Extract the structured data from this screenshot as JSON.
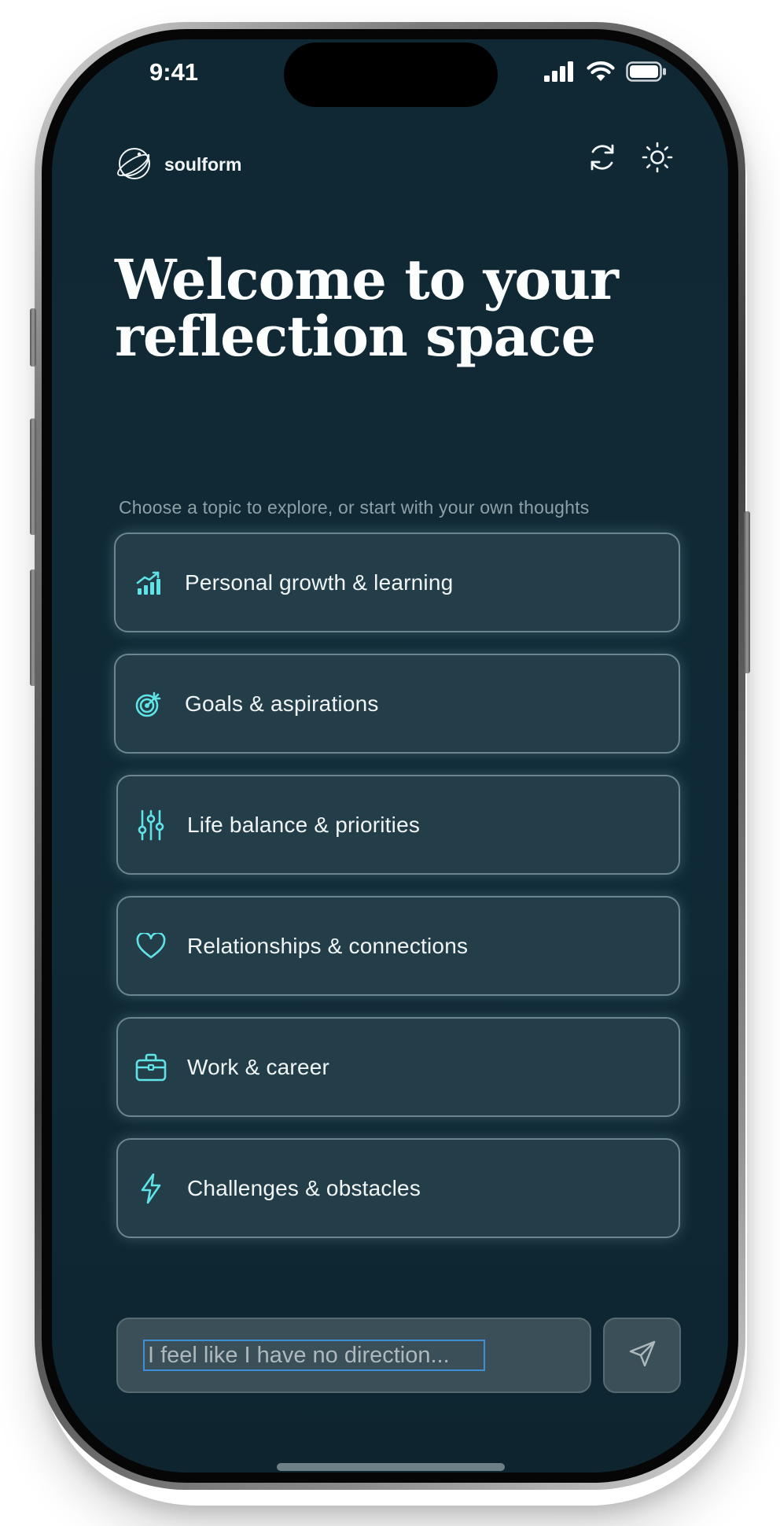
{
  "status_bar": {
    "time": "9:41",
    "signal_icon": "cellular-signal-icon",
    "wifi_icon": "wifi-icon",
    "battery_icon": "battery-icon"
  },
  "header": {
    "brand": "soulform",
    "logo_icon": "globe-ring-logo-icon",
    "refresh_icon": "refresh-icon",
    "theme_icon": "sun-icon"
  },
  "main": {
    "headline": "Welcome to your reflection space",
    "subtitle": "Choose a topic to explore, or start with your own thoughts",
    "topics": [
      {
        "label": "Personal growth & learning",
        "icon": "growth-chart-icon"
      },
      {
        "label": "Goals & aspirations",
        "icon": "target-icon"
      },
      {
        "label": "Life balance & priorities",
        "icon": "sliders-icon"
      },
      {
        "label": "Relationships & connections",
        "icon": "heart-icon"
      },
      {
        "label": "Work & career",
        "icon": "briefcase-icon"
      },
      {
        "label": "Challenges & obstacles",
        "icon": "lightning-icon"
      }
    ]
  },
  "composer": {
    "placeholder": "I feel like I have no direction...",
    "send_icon": "send-icon"
  },
  "colors": {
    "background": "#102833",
    "card": "#243e49",
    "card_border": "#6c8590",
    "accent": "#5fe3e6",
    "text": "#f0f5f6",
    "muted": "#8ea1a8"
  }
}
